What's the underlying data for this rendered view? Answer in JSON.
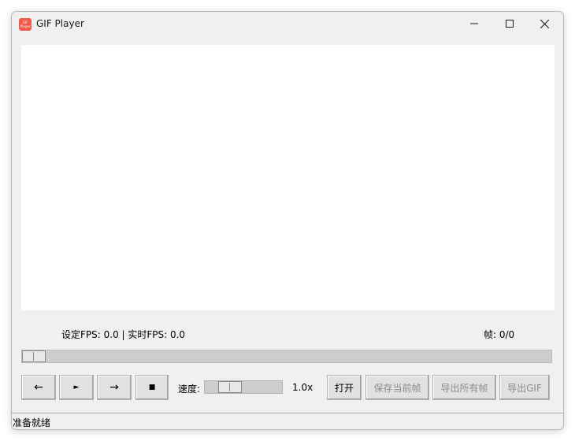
{
  "window": {
    "title": "GIF Player",
    "icon_text": "GIF\nPlayer",
    "icon_color": "#f05a4e"
  },
  "info": {
    "fps_text": "设定FPS: 0.0 | 实时FPS: 0.0",
    "frame_text": "帧: 0/0"
  },
  "progress": {
    "position": 0.0
  },
  "controls": {
    "prev_label": "←",
    "play_label": "►",
    "next_label": "→",
    "stop_label": "■",
    "speed_label": "速度:",
    "speed_value": "1.0x",
    "speed_level": 0.25,
    "open_label": "打开",
    "save_frame_label": "保存当前帧",
    "export_frames_label": "导出所有帧",
    "export_gif_label": "导出GIF"
  },
  "status": {
    "text": "准备就绪"
  }
}
